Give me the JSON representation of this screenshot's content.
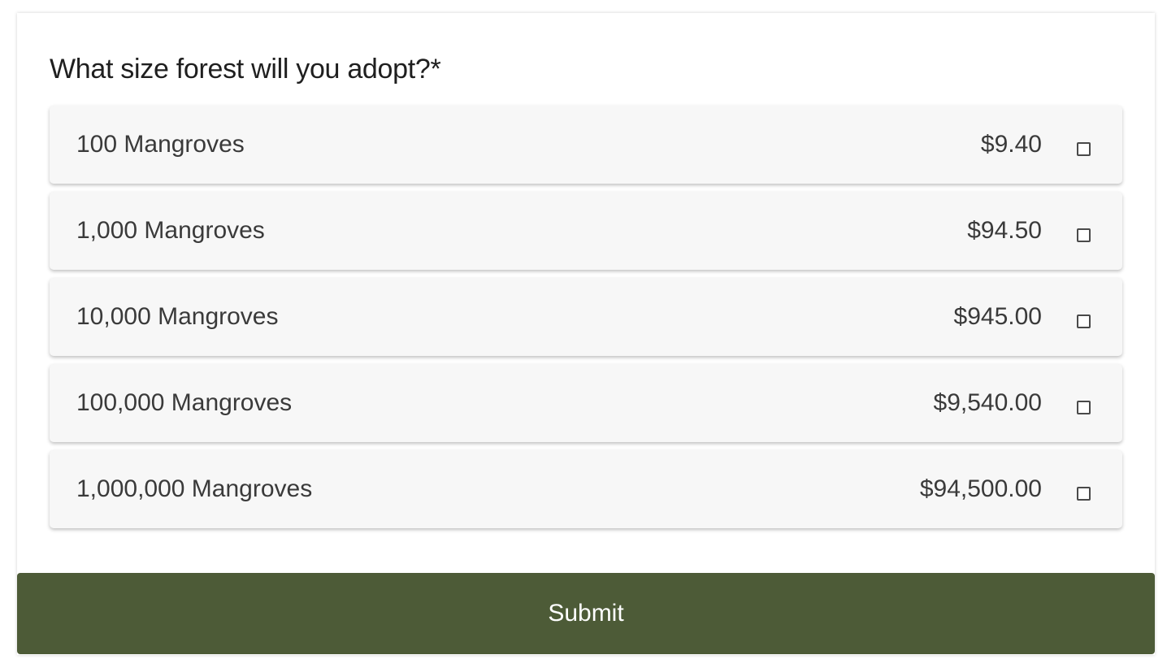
{
  "form": {
    "question": "What size forest will you adopt?*",
    "options": [
      {
        "label": "100 Mangroves",
        "price": "$9.40",
        "checked": false
      },
      {
        "label": "1,000 Mangroves",
        "price": "$94.50",
        "checked": false
      },
      {
        "label": "10,000 Mangroves",
        "price": "$945.00",
        "checked": false
      },
      {
        "label": "100,000 Mangroves",
        "price": "$9,540.00",
        "checked": false
      },
      {
        "label": "1,000,000 Mangroves",
        "price": "$94,500.00",
        "checked": false
      }
    ],
    "submit_label": "Submit"
  },
  "colors": {
    "submit_background": "#4d5b37",
    "option_background": "#f7f7f7",
    "text": "#3a3a3a"
  }
}
